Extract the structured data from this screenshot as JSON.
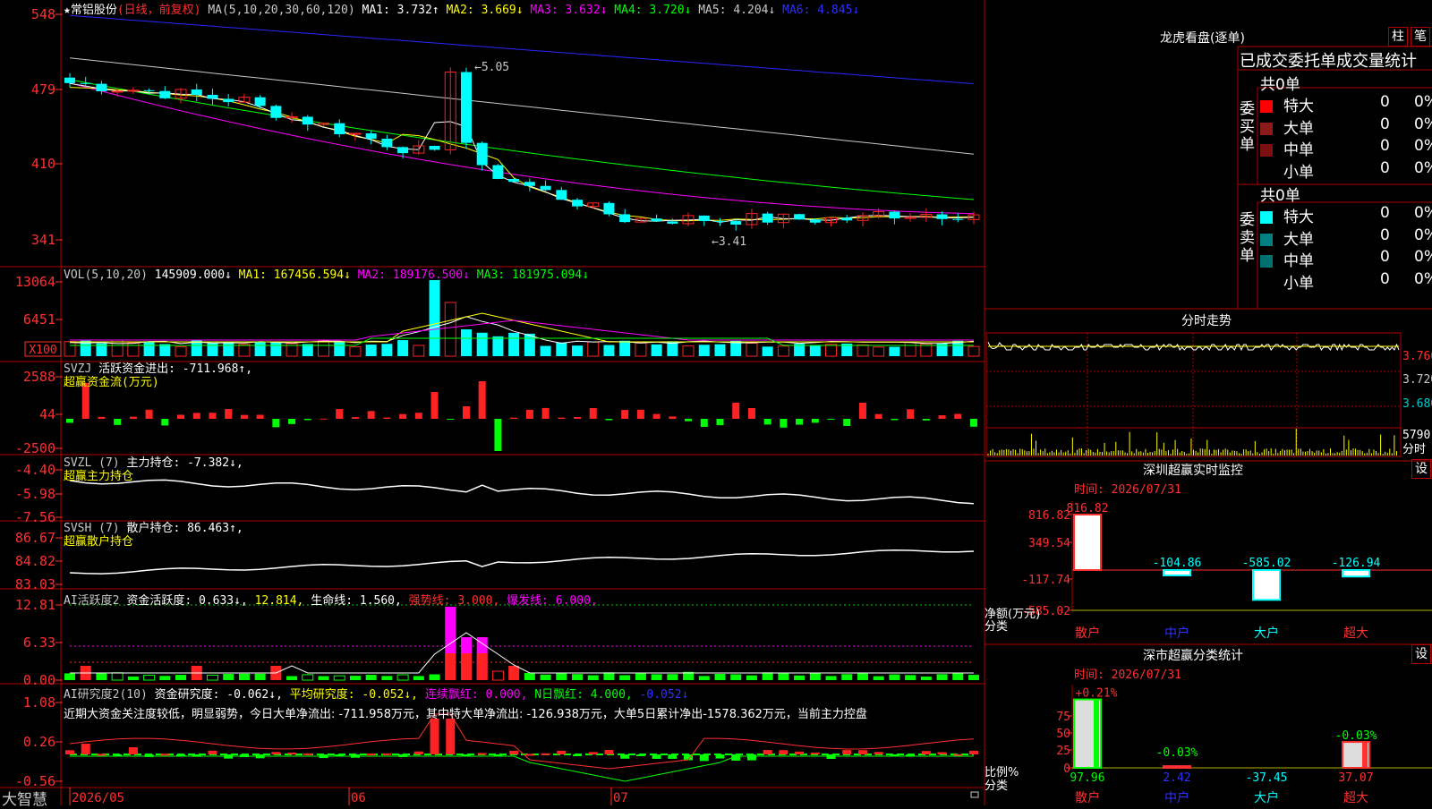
{
  "colors": {
    "up": "#ff2222",
    "down": "#00ffff",
    "ma1": "#ffffff",
    "ma2": "#ffff00",
    "ma3": "#ff00ff",
    "ma4": "#00ff00",
    "ma5": "#c8c8c8",
    "ma6": "#2828ff",
    "grid": "#b00000",
    "text": "#c8c8c8",
    "green": "#00ff00"
  },
  "app": {
    "brand": "大智慧"
  },
  "kline": {
    "header": {
      "star": "★",
      "stock": "常铝股份",
      "mode": "(日线，前复权)",
      "ma_label": "MA(5,10,20,30,60,120)",
      "ma1": "MA1: 3.732↑",
      "ma2": "MA2: 3.669↓",
      "ma3": "MA3: 3.632↓",
      "ma4": "MA4: 3.720↓",
      "ma5": "MA5: 4.204↓",
      "ma6": "MA6: 4.845↓"
    },
    "yticks": [
      "548",
      "479",
      "410",
      "341"
    ],
    "high_label": "←5.05",
    "low_label": "←3.41",
    "xlabels": [
      "2026/05",
      "06",
      "07"
    ]
  },
  "vol": {
    "header": {
      "name": "VOL(5,10,20)",
      "value": "145909.000↓",
      "ma1": "MA1: 167456.594↓",
      "ma2": "MA2: 189176.500↓",
      "ma3": "MA3: 181975.094↓"
    },
    "yticks": [
      "13064",
      "6451",
      "X100"
    ]
  },
  "svzj": {
    "header": {
      "name": "SVZJ",
      "text": "活跃资金进出: -711.968↑,",
      "sub": "超赢资金流(万元)"
    },
    "yticks": [
      "2588",
      "44",
      "-2500"
    ]
  },
  "svzl": {
    "header": {
      "name": "SVZL (7)",
      "text": "主力持仓: -7.382↓,",
      "sub": "超赢主力持仓"
    },
    "yticks": [
      "-4.40",
      "-5.98",
      "-7.56"
    ]
  },
  "svsh": {
    "header": {
      "name": "SVSH (7)",
      "text": "散户持仓: 86.463↑,",
      "sub": "超赢散户持仓"
    },
    "yticks": [
      "86.67",
      "84.82",
      "83.03"
    ]
  },
  "aihy": {
    "header": {
      "name": "AI活跃度2",
      "a": "资金活跃度: 0.633↓,",
      "b": "12.814,",
      "c": "生命线: 1.560,",
      "d": "强势线: 3.000,",
      "e": "爆发线: 6.000,"
    },
    "yticks": [
      "12.81",
      "6.33",
      "0.00"
    ]
  },
  "aiyj": {
    "header": {
      "name": "AI研究度2(10)",
      "a": "资金研究度: -0.062↓,",
      "b": "平均研究度: -0.052↓,",
      "c": "连续飘红: 0.000,",
      "d": "N日飘红: 4.000,",
      "e": "-0.052↓"
    },
    "comment": "近期大资金关注度较低，明显弱势，今日大单净流出: -711.958万元，其中特大单净流出: -126.938万元，大单5日累计净出-1578.362万元，当前主力控盘",
    "yticks": [
      "1.08",
      "0.26",
      "-0.56"
    ]
  },
  "longhu": {
    "title": "龙虎看盘(逐单)",
    "btn1": "柱",
    "btn2": "笔",
    "subtitle": "已成交委托单成交量统计",
    "buy": {
      "label": "委买单",
      "total": "共0单",
      "rows": [
        {
          "name": "特大",
          "v": "0",
          "p": "0%"
        },
        {
          "name": "大单",
          "v": "0",
          "p": "0%"
        },
        {
          "name": "中单",
          "v": "0",
          "p": "0%"
        },
        {
          "name": "小单",
          "v": "0",
          "p": "0%"
        }
      ]
    },
    "sell": {
      "label": "委卖单",
      "total": "共0单",
      "rows": [
        {
          "name": "特大",
          "v": "0",
          "p": "0%"
        },
        {
          "name": "大单",
          "v": "0",
          "p": "0%"
        },
        {
          "name": "中单",
          "v": "0",
          "p": "0%"
        },
        {
          "name": "小单",
          "v": "0",
          "p": "0%"
        }
      ]
    }
  },
  "fenshi": {
    "title": "分时走势",
    "yticks": [
      "3.760",
      "3.720",
      "3.680"
    ],
    "vol_top": "5790",
    "vol_label": "分时"
  },
  "monitor": {
    "title": "深圳超赢实时监控",
    "btn": "设",
    "time": "时间: 2026/07/31",
    "yticks": [
      "816.82",
      "349.54",
      "-117.74",
      "-585.02"
    ],
    "ylabel": "净额(万元)",
    "xlabel": "分类",
    "bars": [
      {
        "name": "散户",
        "value": 816.82,
        "label": "816.82"
      },
      {
        "name": "中户",
        "value": -104.86,
        "label": "-104.86"
      },
      {
        "name": "大户",
        "value": -585.02,
        "label": "-585.02"
      },
      {
        "name": "超大",
        "value": -126.94,
        "label": "-126.94"
      }
    ]
  },
  "classify": {
    "title": "深市超赢分类统计",
    "btn": "设",
    "time": "时间: 2026/07/31",
    "yticks": [
      "75",
      "50",
      "25",
      "0"
    ],
    "ylabel": "比例%",
    "xlabel": "分类",
    "bars": [
      {
        "name": "散户",
        "pct": 0.21,
        "top_label": "+0.21%",
        "bottom": "97.96",
        "height": 97.96
      },
      {
        "name": "中户",
        "pct": -0.03,
        "top_label": "-0.03%",
        "bottom": "2.42",
        "height": 2.42
      },
      {
        "name": "大户",
        "pct": 0,
        "top_label": "",
        "bottom": "-37.45",
        "height": 0
      },
      {
        "name": "超大",
        "pct": -0.03,
        "top_label": "-0.03%",
        "bottom": "37.07",
        "height": 37.07
      }
    ]
  },
  "chart_data": {
    "type": "bar",
    "title": "",
    "categories": [
      "散户",
      "中户",
      "大户",
      "超大"
    ],
    "series": [
      {
        "values": [
          816.82,
          -104.86,
          -585.02,
          -126.94
        ]
      }
    ],
    "ylim": [
      -585.02,
      816.82
    ],
    "ylabel": "净额(万元)",
    "xlabel": "分类"
  }
}
